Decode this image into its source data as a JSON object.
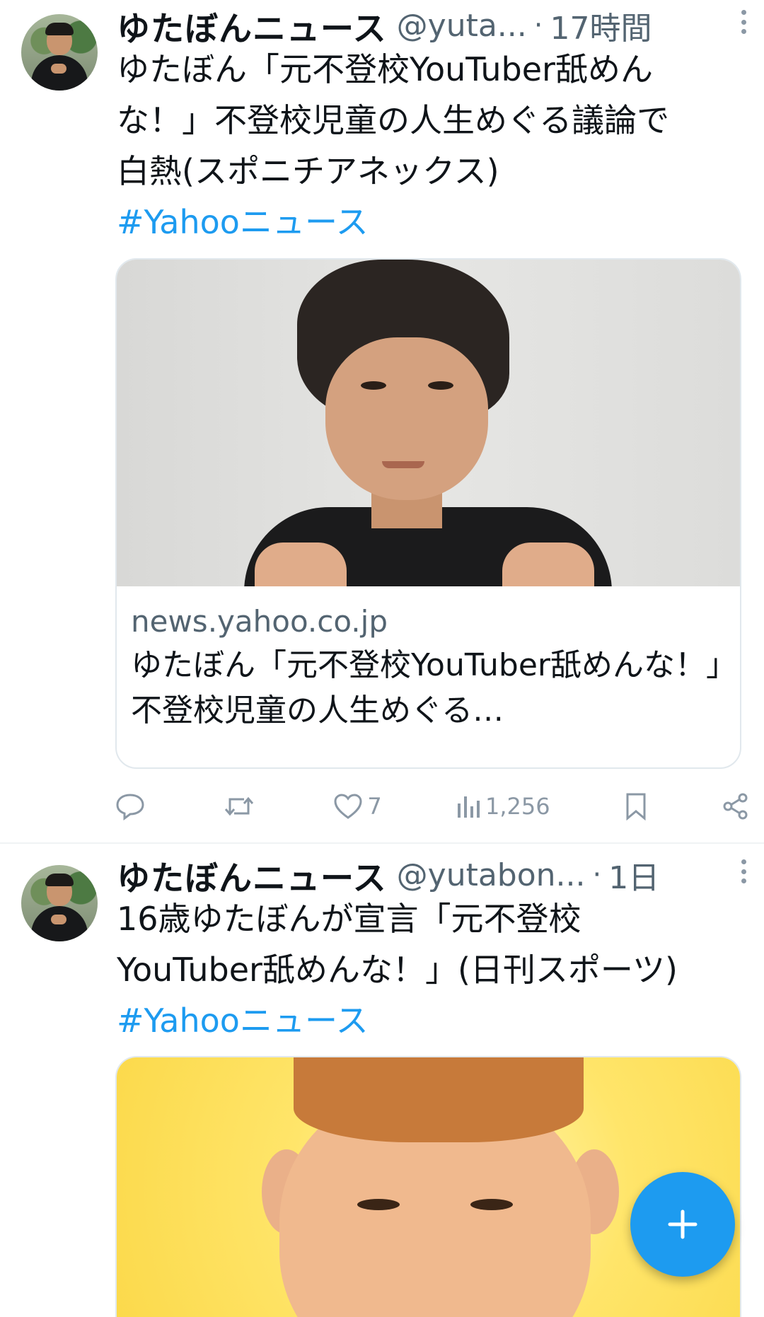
{
  "tweets": [
    {
      "author_name": "ゆたぼんニュース",
      "handle": "@yuta...",
      "separator": "·",
      "time": "17時間",
      "text_lines": [
        "ゆたぼん「元不登校YouTuber舐めん",
        "な！」不登校児童の人生めぐる議論で",
        "白熱(スポニチアネックス)"
      ],
      "hashtag": "#Yahooニュース",
      "card": {
        "domain": "news.yahoo.co.jp",
        "title": "ゆたぼん「元不登校YouTuber舐めんな！」不登校児童の人生めぐる…"
      },
      "actions": {
        "reply_count": "",
        "retweet_count": "",
        "like_count": "7",
        "views_count": "1,256"
      }
    },
    {
      "author_name": "ゆたぼんニュース",
      "handle": "@yutabon...",
      "separator": "·",
      "time": "1日",
      "text_lines": [
        "16歳ゆたぼんが宣言「元不登校",
        "YouTuber舐めんな！」(日刊スポーツ)"
      ],
      "hashtag": "#Yahooニュース"
    }
  ],
  "fab": {
    "icon": "plus-icon"
  },
  "colors": {
    "accent": "#1d9bf0",
    "secondary_text": "#536471",
    "border": "#e1e8ed"
  }
}
